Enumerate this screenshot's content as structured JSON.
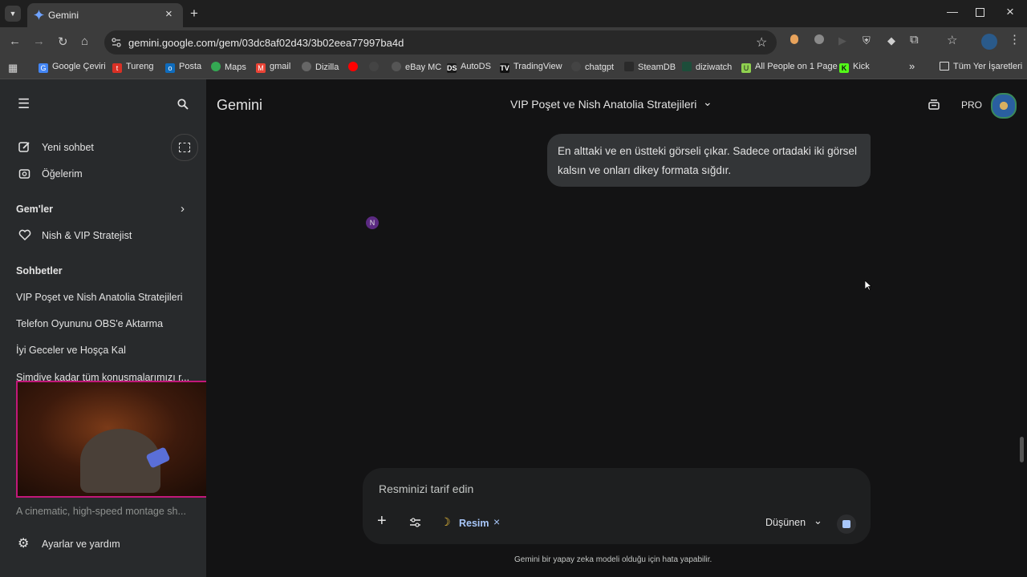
{
  "browser": {
    "tab_title": "Gemini",
    "url": "gemini.google.com/gem/03dc8af02d43/3b02eea77997ba4d",
    "bookmarks": [
      "Google Çeviri",
      "Tureng",
      "Posta",
      "Maps",
      "gmail",
      "Dizilla",
      "eBay MC",
      "AutoDS",
      "TradingView",
      "chatgpt",
      "SteamDB",
      "diziwatch",
      "All People on 1 Page",
      "Kick"
    ],
    "other_bookmarks": "Tüm Yer İşaretleri",
    "bookmark_badges": {
      "autods": "DS",
      "tradingview": "TV",
      "kick": "K",
      "allpeople": "U"
    }
  },
  "sidebar": {
    "new_chat": "Yeni sohbet",
    "items": "Öğelerim",
    "gems_header": "Gem'ler",
    "gem_item": "Nish & VIP Stratejist",
    "chats_header": "Sohbetler",
    "chats": [
      "VIP Poşet ve Nish Anatolia Stratejileri",
      "Telefon Oyununu OBS'e Aktarma",
      "İyi Geceler ve Hoşça Kal",
      "Şimdiye kadar tüm konuşmalarımızı r...",
      "A cinematic, high-speed montage sh..."
    ],
    "settings": "Ayarlar ve yardım"
  },
  "header": {
    "brand": "Gemini",
    "chat_title": "VIP Poşet ve Nish Anatolia Stratejileri",
    "pro_badge": "PRO"
  },
  "conversation": {
    "user_message": "En alttaki ve en üstteki görseli çıkar. Sadece ortadaki iki görsel kalsın ve onları dikey formata sığdır.",
    "response_avatar": "N"
  },
  "composer": {
    "placeholder": "Resminizi tarif edin",
    "tool_chip": "Resim",
    "mode": "Düşünen"
  },
  "footer": {
    "disclaimer": "Gemini bir yapay zeka modeli olduğu için hata yapabilir."
  },
  "colors": {
    "main_bg": "#131314",
    "sidebar_bg": "#282a2c",
    "bubble_bg": "#333537",
    "chip_blue": "#a8c7fa",
    "overlay_pink": "#c2187a"
  }
}
